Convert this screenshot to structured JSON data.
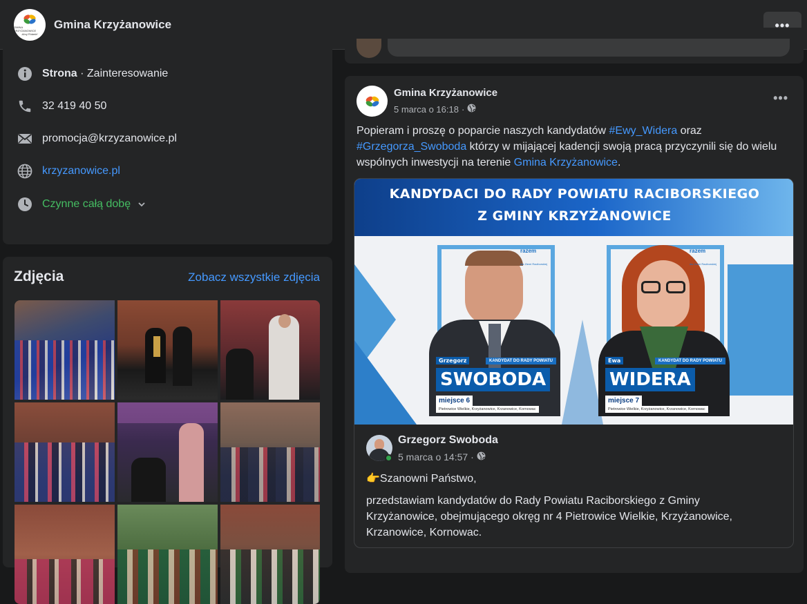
{
  "header": {
    "page_name": "Gmina Krzyżanowice",
    "more_label": "•••",
    "logo_text": "GMINA KRZYŻANOWICE",
    "logo_tagline": "Ahoj Přátelé!"
  },
  "intro": {
    "category_bold": "Strona",
    "category_rest": " · Zainteresowanie",
    "phone": "32 419 40 50",
    "email": "promocja@krzyzanowice.pl",
    "website": "krzyzanowice.pl",
    "hours": "Czynne całą dobę"
  },
  "photos": {
    "title": "Zdjęcia",
    "see_all": "Zobacz wszystkie zdjęcia"
  },
  "post": {
    "author": "Gmina Krzyżanowice",
    "date": "5 marca o 16:18",
    "dot": "·",
    "more_label": "•••",
    "text_1": "Popieram i proszę o poparcie naszych kandydatów ",
    "hashtag_1": "#Ewy_Widera",
    "text_2": " oraz ",
    "hashtag_2": "#Grzegorza_Swoboda",
    "text_3": " którzy w mijającej kadencji swoją pracą przyczynili się do wielu wspólnych inwestycji na terenie ",
    "mention": "Gmina Krzyżanowice",
    "text_4": "."
  },
  "banner": {
    "line_1": "KANDYDACI DO RADY POWIATU RACIBORSKIEGO",
    "line_2": "Z GMINY KRZYŻANOWICE",
    "brand": "razem",
    "brand_sub": "dla Ziemi Raciborskiej",
    "candidate_1": {
      "first_name": "Grzegorz",
      "last_name": "SWOBODA",
      "tag": "KANDYDAT DO RADY POWIATU",
      "place": "miejsce 6",
      "towns": "Pietrowice Wielkie, Krzyżanowice, Krzanowice, Kornowac"
    },
    "candidate_2": {
      "first_name": "Ewa",
      "last_name": "WIDERA",
      "tag": "KANDYDAT DO RADY POWIATU",
      "place": "miejsce 7",
      "towns": "Pietrowice Wielkie, Krzyżanowice, Krzanowice, Kornowac"
    }
  },
  "shared": {
    "author": "Grzegorz Swoboda",
    "date": "5 marca o 14:57",
    "dot": "·",
    "greeting": "👉Szanowni Państwo,",
    "body": "przedstawiam kandydatów do Rady Powiatu Raciborskiego z Gminy Krzyżanowice, obejmującego okręg nr 4 Pietrowice Wielkie,  Krzyżanowice, Krzanowice, Kornowac."
  }
}
